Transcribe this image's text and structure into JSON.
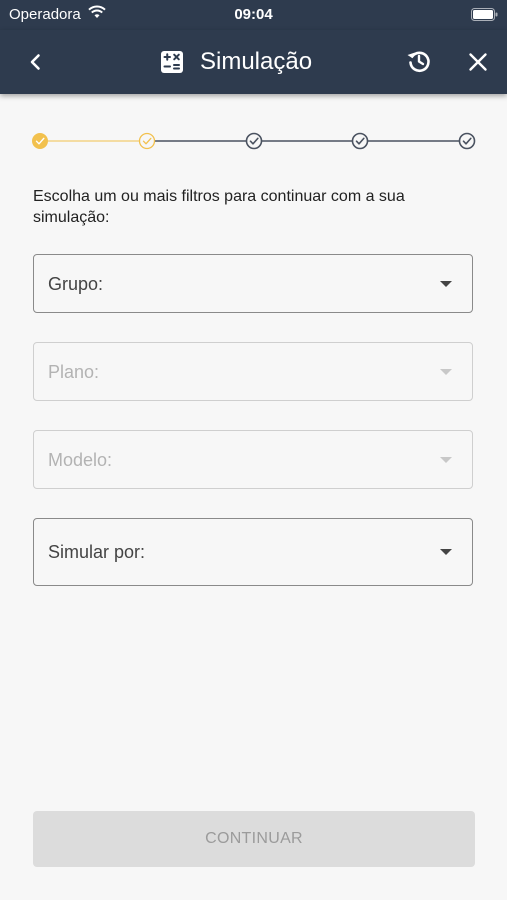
{
  "status_bar": {
    "carrier": "Operadora",
    "time": "09:04"
  },
  "app_bar": {
    "title": "Simulação",
    "icons": [
      "back-icon",
      "calculator-icon",
      "history-icon",
      "close-icon"
    ]
  },
  "stepper": {
    "steps": [
      {
        "state": "active"
      },
      {
        "state": "current"
      },
      {
        "state": "pending"
      },
      {
        "state": "pending"
      },
      {
        "state": "pending"
      }
    ],
    "colors": {
      "done": "#f2c14e",
      "pending": "#4a5260"
    }
  },
  "instructions": "Escolha um ou mais filtros para continuar com a sua simulação:",
  "filters": {
    "grupo": {
      "label": "Grupo:",
      "enabled": true
    },
    "plano": {
      "label": "Plano:",
      "enabled": false
    },
    "modelo": {
      "label": "Modelo:",
      "enabled": false
    },
    "simular_por": {
      "label": "Simular por:",
      "enabled": true
    }
  },
  "continue_button": {
    "label": "CONTINUAR",
    "enabled": false
  },
  "colors": {
    "header": "#2e3b4e",
    "background": "#f7f7f7",
    "accent": "#f2c14e"
  }
}
